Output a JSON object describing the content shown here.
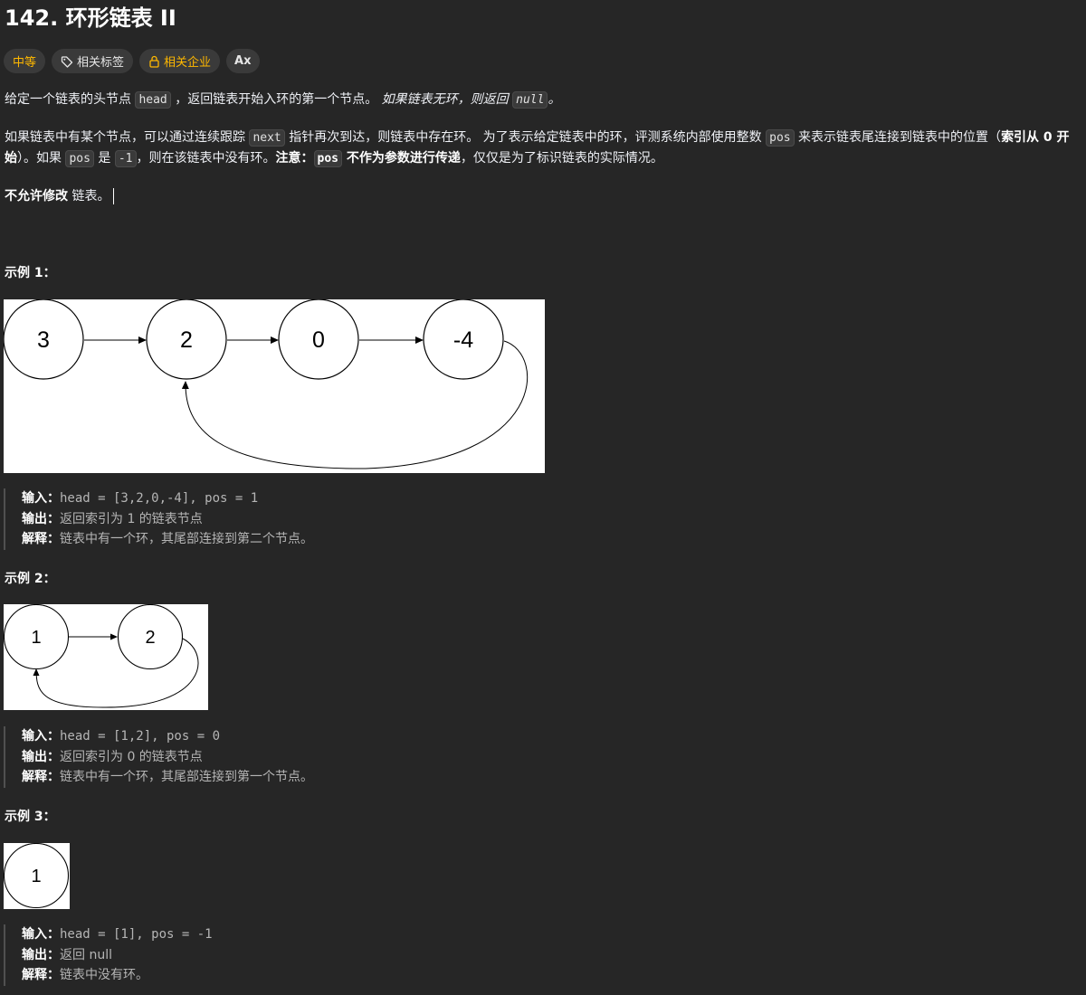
{
  "problem": {
    "title": "142. 环形链表 II"
  },
  "tags": {
    "difficulty": "中等",
    "related_tags": "相关标签",
    "related_companies": "相关企业",
    "lang_icon": "Ax"
  },
  "icons": {
    "tag": "tag-icon",
    "lock": "lock-icon",
    "translate": "translate-icon"
  },
  "colors": {
    "background": "#262626",
    "difficulty": "#ffb800",
    "text": "#eff1f6"
  },
  "desc": {
    "p1_a": "给定一个链表的头节点 ",
    "p1_code1": "head",
    "p1_b": " ，返回链表开始入环的第一个节点。 ",
    "p1_c": "如果链表无环，则返回 ",
    "p1_code2": "null",
    "p1_d": "。",
    "p2_a": "如果链表中有某个节点，可以通过连续跟踪 ",
    "p2_code1": "next",
    "p2_b": " 指针再次到达，则链表中存在环。 为了表示给定链表中的环，评测系统内部使用整数 ",
    "p2_code2": "pos",
    "p2_c": " 来表示链表尾连接到链表中的位置（",
    "p2_bold1": "索引从 0 开始",
    "p2_d": "）。如果 ",
    "p2_code3": "pos",
    "p2_e": " 是 ",
    "p2_code4": "-1",
    "p2_f": "，则在该链表中没有环。",
    "p2_bold2": "注意：",
    "p2_code5": "pos",
    "p2_bold3": " 不作为参数进行传递",
    "p2_g": "，仅仅是为了标识链表的实际情况。",
    "p3_bold": "不允许修改",
    "p3_rest": " 链表。"
  },
  "examples": [
    {
      "heading": "示例 1：",
      "nodes": [
        "3",
        "2",
        "0",
        "-4"
      ],
      "input_label": "输入：",
      "input": "head = [3,2,0,-4], pos = 1",
      "output_label": "输出：",
      "output": "返回索引为 1 的链表节点",
      "explain_label": "解释：",
      "explain": "链表中有一个环，其尾部连接到第二个节点。"
    },
    {
      "heading": "示例 2：",
      "nodes": [
        "1",
        "2"
      ],
      "input_label": "输入：",
      "input": "head = [1,2], pos = 0",
      "output_label": "输出：",
      "output": "返回索引为 0 的链表节点",
      "explain_label": "解释：",
      "explain": "链表中有一个环，其尾部连接到第一个节点。"
    },
    {
      "heading": "示例 3：",
      "nodes": [
        "1"
      ],
      "input_label": "输入：",
      "input": "head = [1], pos = -1",
      "output_label": "输出：",
      "output": "返回 null",
      "explain_label": "解释：",
      "explain": "链表中没有环。"
    }
  ]
}
